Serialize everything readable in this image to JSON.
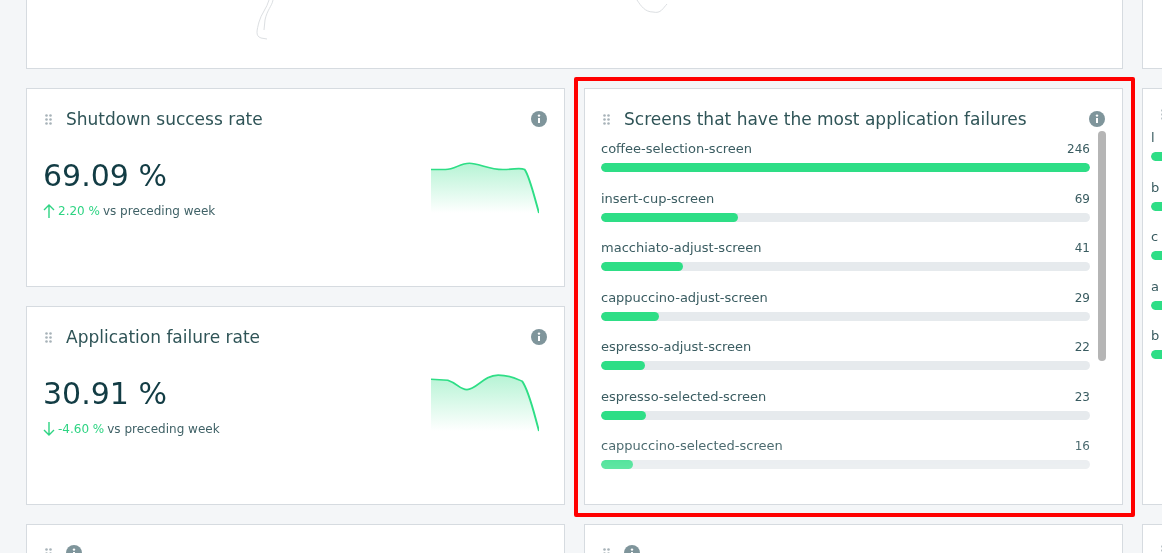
{
  "kpis": [
    {
      "title": "Shutdown success rate",
      "value": "69.09 %",
      "kind": "up",
      "delta": "2.20 %",
      "comparison": "vs preceding week"
    },
    {
      "title": "Application failure rate",
      "value": "30.91 %",
      "kind": "down",
      "delta": "-4.60 %",
      "comparison": "vs preceding week"
    }
  ],
  "failures_card": {
    "title": "Screens that have the most application failures",
    "items": [
      {
        "name": "coffee-selection-screen",
        "count": "246",
        "level": 1
      },
      {
        "name": "insert-cup-screen",
        "count": "69",
        "level": 0.28
      },
      {
        "name": "macchiato-adjust-screen",
        "count": "41",
        "level": 0.167
      },
      {
        "name": "cappuccino-adjust-screen",
        "count": "29",
        "level": 0.118
      },
      {
        "name": "espresso-adjust-screen",
        "count": "22",
        "level": 0.09
      },
      {
        "name": "espresso-selected-screen",
        "count": "23",
        "level": 0.093
      },
      {
        "name": "cappuccino-selected-screen",
        "count": "16",
        "level": 0.065
      }
    ]
  },
  "right_card": {
    "items": [
      {
        "name": "l"
      },
      {
        "name": "b"
      },
      {
        "name": "c"
      },
      {
        "name": "a"
      },
      {
        "name": "b"
      }
    ]
  }
}
